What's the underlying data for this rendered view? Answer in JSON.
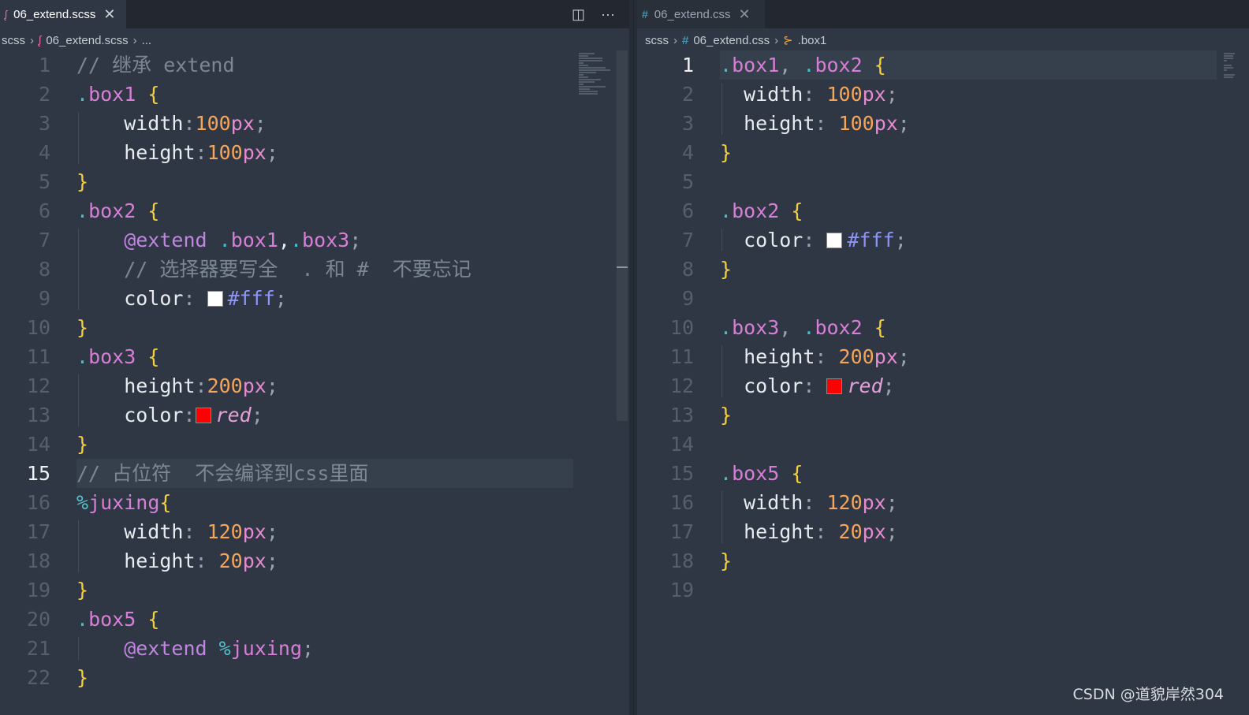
{
  "left_editor": {
    "tab": {
      "icon": "sass-icon",
      "label": "06_extend.scss"
    },
    "actions": {
      "split": "split-editor-icon",
      "more": "more-actions-icon"
    },
    "breadcrumb": [
      "scss",
      "06_extend.scss",
      "..."
    ],
    "current_line": 15,
    "lines": [
      [
        [
          "// 继承 extend",
          "c-com"
        ]
      ],
      [
        [
          ".",
          "c-dot"
        ],
        [
          "box1",
          "c-cls"
        ],
        [
          " ",
          "c-pun"
        ],
        [
          "{",
          "c-brc"
        ]
      ],
      [
        [
          "    width",
          "c-prop"
        ],
        [
          ":",
          "c-pun"
        ],
        [
          "100",
          "c-num"
        ],
        [
          "px",
          "c-unit"
        ],
        [
          ";",
          "c-pun"
        ]
      ],
      [
        [
          "    height",
          "c-prop"
        ],
        [
          ":",
          "c-pun"
        ],
        [
          "100",
          "c-num"
        ],
        [
          "px",
          "c-unit"
        ],
        [
          ";",
          "c-pun"
        ]
      ],
      [
        [
          "}",
          "c-brc"
        ]
      ],
      [
        [
          ".",
          "c-dot"
        ],
        [
          "box2",
          "c-cls"
        ],
        [
          " ",
          "c-pun"
        ],
        [
          "{",
          "c-brc"
        ]
      ],
      [
        [
          "    @extend ",
          "c-at"
        ],
        [
          ".",
          "c-dot"
        ],
        [
          "box1",
          "c-cls"
        ],
        [
          ",",
          "c-prop"
        ],
        [
          ".",
          "c-dot"
        ],
        [
          "box3",
          "c-cls"
        ],
        [
          ";",
          "c-pun"
        ]
      ],
      [
        [
          "    // 选择器要写全  . 和 #  不要忘记",
          "c-com"
        ]
      ],
      [
        [
          "    color",
          "c-prop"
        ],
        [
          ": ",
          "c-pun"
        ],
        [
          "#fff",
          "swatch:#ffffff"
        ],
        [
          "#fff",
          "c-hex"
        ],
        [
          ";",
          "c-pun"
        ]
      ],
      [
        [
          "}",
          "c-brc"
        ]
      ],
      [
        [
          ".",
          "c-dot"
        ],
        [
          "box3",
          "c-cls"
        ],
        [
          " ",
          "c-pun"
        ],
        [
          "{",
          "c-brc"
        ]
      ],
      [
        [
          "    height",
          "c-prop"
        ],
        [
          ":",
          "c-pun"
        ],
        [
          "200",
          "c-num"
        ],
        [
          "px",
          "c-unit"
        ],
        [
          ";",
          "c-pun"
        ]
      ],
      [
        [
          "    color",
          "c-prop"
        ],
        [
          ":",
          "c-pun"
        ],
        [
          "red",
          "swatch:#ff0000"
        ],
        [
          "red",
          "c-red"
        ],
        [
          ";",
          "c-pun"
        ]
      ],
      [
        [
          "}",
          "c-brc"
        ]
      ],
      [
        [
          "// 占位符  不会编译到css里面",
          "c-com"
        ]
      ],
      [
        [
          "%",
          "c-pct"
        ],
        [
          "juxing",
          "c-cls"
        ],
        [
          "{",
          "c-brc"
        ]
      ],
      [
        [
          "    width",
          "c-prop"
        ],
        [
          ": ",
          "c-pun"
        ],
        [
          "120",
          "c-num"
        ],
        [
          "px",
          "c-unit"
        ],
        [
          ";",
          "c-pun"
        ]
      ],
      [
        [
          "    height",
          "c-prop"
        ],
        [
          ": ",
          "c-pun"
        ],
        [
          "20",
          "c-num"
        ],
        [
          "px",
          "c-unit"
        ],
        [
          ";",
          "c-pun"
        ]
      ],
      [
        [
          "}",
          "c-brc"
        ]
      ],
      [
        [
          ".",
          "c-dot"
        ],
        [
          "box5",
          "c-cls"
        ],
        [
          " ",
          "c-pun"
        ],
        [
          "{",
          "c-brc"
        ]
      ],
      [
        [
          "    @extend ",
          "c-at"
        ],
        [
          "%",
          "c-pct"
        ],
        [
          "juxing",
          "c-cls"
        ],
        [
          ";",
          "c-pun"
        ]
      ],
      [
        [
          "}",
          "c-brc"
        ]
      ]
    ]
  },
  "right_editor": {
    "tab": {
      "icon": "hash-icon",
      "label": "06_extend.css"
    },
    "breadcrumb": [
      "scss",
      "06_extend.css",
      ".box1"
    ],
    "current_line": 1,
    "lines": [
      [
        [
          ".",
          "c-dot"
        ],
        [
          "box1",
          "c-cls"
        ],
        [
          ", ",
          "c-pun"
        ],
        [
          ".",
          "c-dot"
        ],
        [
          "box2",
          "c-cls"
        ],
        [
          " ",
          "c-pun"
        ],
        [
          "{",
          "c-brc"
        ]
      ],
      [
        [
          "  width",
          "c-prop"
        ],
        [
          ": ",
          "c-pun"
        ],
        [
          "100",
          "c-num"
        ],
        [
          "px",
          "c-unit"
        ],
        [
          ";",
          "c-pun"
        ]
      ],
      [
        [
          "  height",
          "c-prop"
        ],
        [
          ": ",
          "c-pun"
        ],
        [
          "100",
          "c-num"
        ],
        [
          "px",
          "c-unit"
        ],
        [
          ";",
          "c-pun"
        ]
      ],
      [
        [
          "}",
          "c-brc"
        ]
      ],
      [],
      [
        [
          ".",
          "c-dot"
        ],
        [
          "box2",
          "c-cls"
        ],
        [
          " ",
          "c-pun"
        ],
        [
          "{",
          "c-brc"
        ]
      ],
      [
        [
          "  color",
          "c-prop"
        ],
        [
          ": ",
          "c-pun"
        ],
        [
          "#fff",
          "swatch:#ffffff"
        ],
        [
          "#fff",
          "c-hex"
        ],
        [
          ";",
          "c-pun"
        ]
      ],
      [
        [
          "}",
          "c-brc"
        ]
      ],
      [],
      [
        [
          ".",
          "c-dot"
        ],
        [
          "box3",
          "c-cls"
        ],
        [
          ", ",
          "c-pun"
        ],
        [
          ".",
          "c-dot"
        ],
        [
          "box2",
          "c-cls"
        ],
        [
          " ",
          "c-pun"
        ],
        [
          "{",
          "c-brc"
        ]
      ],
      [
        [
          "  height",
          "c-prop"
        ],
        [
          ": ",
          "c-pun"
        ],
        [
          "200",
          "c-num"
        ],
        [
          "px",
          "c-unit"
        ],
        [
          ";",
          "c-pun"
        ]
      ],
      [
        [
          "  color",
          "c-prop"
        ],
        [
          ": ",
          "c-pun"
        ],
        [
          "red",
          "swatch:#ff0000"
        ],
        [
          "red",
          "c-red"
        ],
        [
          ";",
          "c-pun"
        ]
      ],
      [
        [
          "}",
          "c-brc"
        ]
      ],
      [],
      [
        [
          ".",
          "c-dot"
        ],
        [
          "box5",
          "c-cls"
        ],
        [
          " ",
          "c-pun"
        ],
        [
          "{",
          "c-brc"
        ]
      ],
      [
        [
          "  width",
          "c-prop"
        ],
        [
          ": ",
          "c-pun"
        ],
        [
          "120",
          "c-num"
        ],
        [
          "px",
          "c-unit"
        ],
        [
          ";",
          "c-pun"
        ]
      ],
      [
        [
          "  height",
          "c-prop"
        ],
        [
          ": ",
          "c-pun"
        ],
        [
          "20",
          "c-num"
        ],
        [
          "px",
          "c-unit"
        ],
        [
          ";",
          "c-pun"
        ]
      ],
      [
        [
          "}",
          "c-brc"
        ]
      ],
      []
    ]
  },
  "watermark": "CSDN @道貌岸然304"
}
